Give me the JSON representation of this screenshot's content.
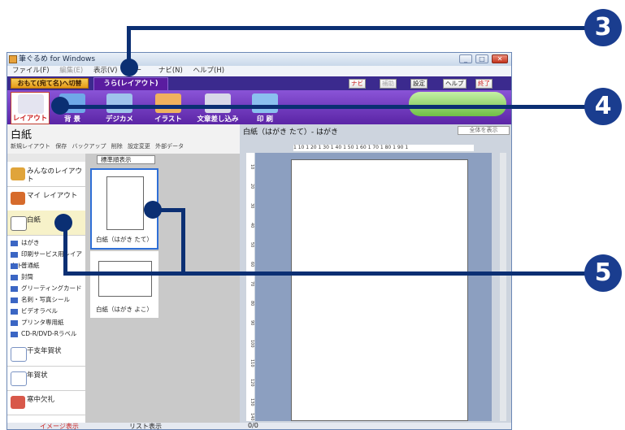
{
  "window": {
    "title": "筆ぐるめ for Windows",
    "buttons": {
      "minimize": "_",
      "maximize": "□",
      "close": "✕"
    }
  },
  "menu": [
    "ファイル(F)",
    "編集(E)",
    "表示(V)",
    "ツー",
    "ナビ(N)",
    "ヘルプ(H)"
  ],
  "tabs": {
    "front": "おもて(宛て名)へ切替",
    "back": "うら(レイアウト)"
  },
  "top_buttons": [
    "ナビ",
    "補助",
    "設定",
    "ヘルプ",
    "終了"
  ],
  "toolbar": [
    {
      "label": "レイアウト",
      "selected": true,
      "color": "#e8e8f4"
    },
    {
      "label": "背 景",
      "selected": false,
      "color": "#6fa8e8"
    },
    {
      "label": "デジカメ",
      "selected": false,
      "color": "#9fc3ec"
    },
    {
      "label": "イラスト",
      "selected": false,
      "color": "#f0b15e"
    },
    {
      "label": "文章差し込み",
      "selected": false,
      "color": "#d8d8e8"
    },
    {
      "label": "印 刷",
      "selected": false,
      "color": "#8bc0ef"
    }
  ],
  "left": {
    "title": "白紙",
    "subtools": [
      "新規レイアウト",
      "保存",
      "バックアップ",
      "削除",
      "設定変更",
      "外部データ"
    ],
    "sort": "標準順表示",
    "bigcats_top": [
      "みんなのレイアウト",
      "マイ レイアウト",
      "白紙"
    ],
    "subcats": [
      "はがき",
      "印刷サービス用レイアウト",
      "普通紙",
      "封筒",
      "グリーティングカード",
      "名刺・写真シール",
      "ビデオラベル",
      "プリンタ専用紙",
      "CD-R/DVD-Rラベル"
    ],
    "bigcats_bottom": [
      "干支年賀状",
      "年賀状",
      "寒中欠礼"
    ],
    "cards": [
      "白紙（はがき たて）",
      "白紙（はがき よこ）"
    ]
  },
  "right": {
    "title": "白紙（はがき たて）- はがき",
    "zoom": "全体を表示",
    "ruler_h": "1 10 1 20 1 30 1 40 1 50 1 60 1 70 1 80 1 90 1",
    "ruler_v": [
      "10",
      "20",
      "30",
      "40",
      "50",
      "60",
      "70",
      "80",
      "90",
      "100",
      "110",
      "120",
      "130",
      "140"
    ]
  },
  "bottom": {
    "image_view": "イメージ表示",
    "list_view": "リスト表示",
    "page": "0/0"
  },
  "callouts": [
    "3",
    "4",
    "5"
  ]
}
